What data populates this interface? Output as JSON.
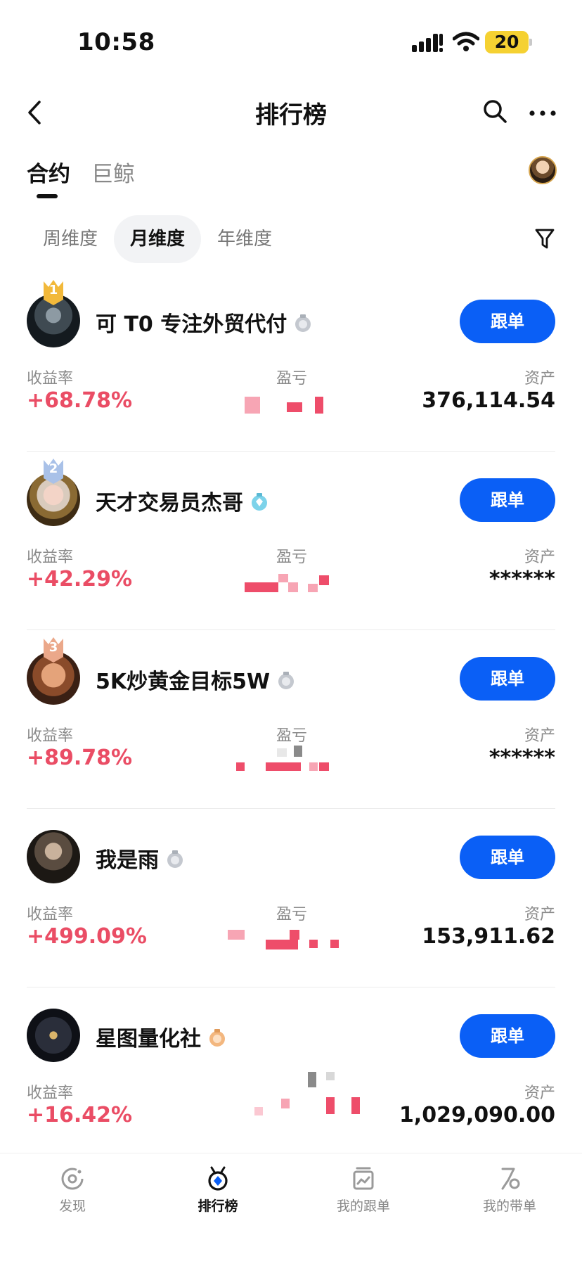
{
  "status_bar": {
    "time": "10:58",
    "battery": "20"
  },
  "header": {
    "title": "排行榜"
  },
  "top_tabs": [
    {
      "label": "合约",
      "active": true
    },
    {
      "label": "巨鲸",
      "active": false
    }
  ],
  "period_tabs": [
    {
      "label": "周维度",
      "active": false
    },
    {
      "label": "月维度",
      "active": true
    },
    {
      "label": "年维度",
      "active": false
    }
  ],
  "stat_labels": {
    "return": "收益率",
    "pnl": "盈亏",
    "assets": "资产"
  },
  "follow_label": "跟单",
  "traders": [
    {
      "rank": "1",
      "name": "可 T0 专注外贸代付",
      "return": "+68.78%",
      "assets": "376,114.54",
      "badge_color": "#f2b93b",
      "level": "silver"
    },
    {
      "rank": "2",
      "name": "天才交易员杰哥",
      "return": "+42.29%",
      "assets": "******",
      "badge_color": "#a9c1e8",
      "level": "diamond"
    },
    {
      "rank": "3",
      "name": "5K炒黄金目标5W",
      "return": "+89.78%",
      "assets": "******",
      "badge_color": "#eba88a",
      "level": "silver"
    },
    {
      "rank": "",
      "name": "我是雨",
      "return": "+499.09%",
      "assets": "153,911.62",
      "badge_color": "",
      "level": "silver"
    },
    {
      "rank": "",
      "name": "星图量化社",
      "return": "+16.42%",
      "assets": "1,029,090.00",
      "badge_color": "",
      "level": "bronze"
    }
  ],
  "bottom_nav": [
    {
      "label": "发现",
      "icon": "discover-icon",
      "active": false
    },
    {
      "label": "排行榜",
      "icon": "ranking-medal-icon",
      "active": true
    },
    {
      "label": "我的跟单",
      "icon": "my-copy-trades-icon",
      "active": false
    },
    {
      "label": "我的带单",
      "icon": "my-lead-trades-icon",
      "active": false
    }
  ],
  "colors": {
    "accent": "#0a5ff6",
    "positive": "#ea4d65",
    "text": "#111111",
    "muted": "#8a8a8a"
  }
}
